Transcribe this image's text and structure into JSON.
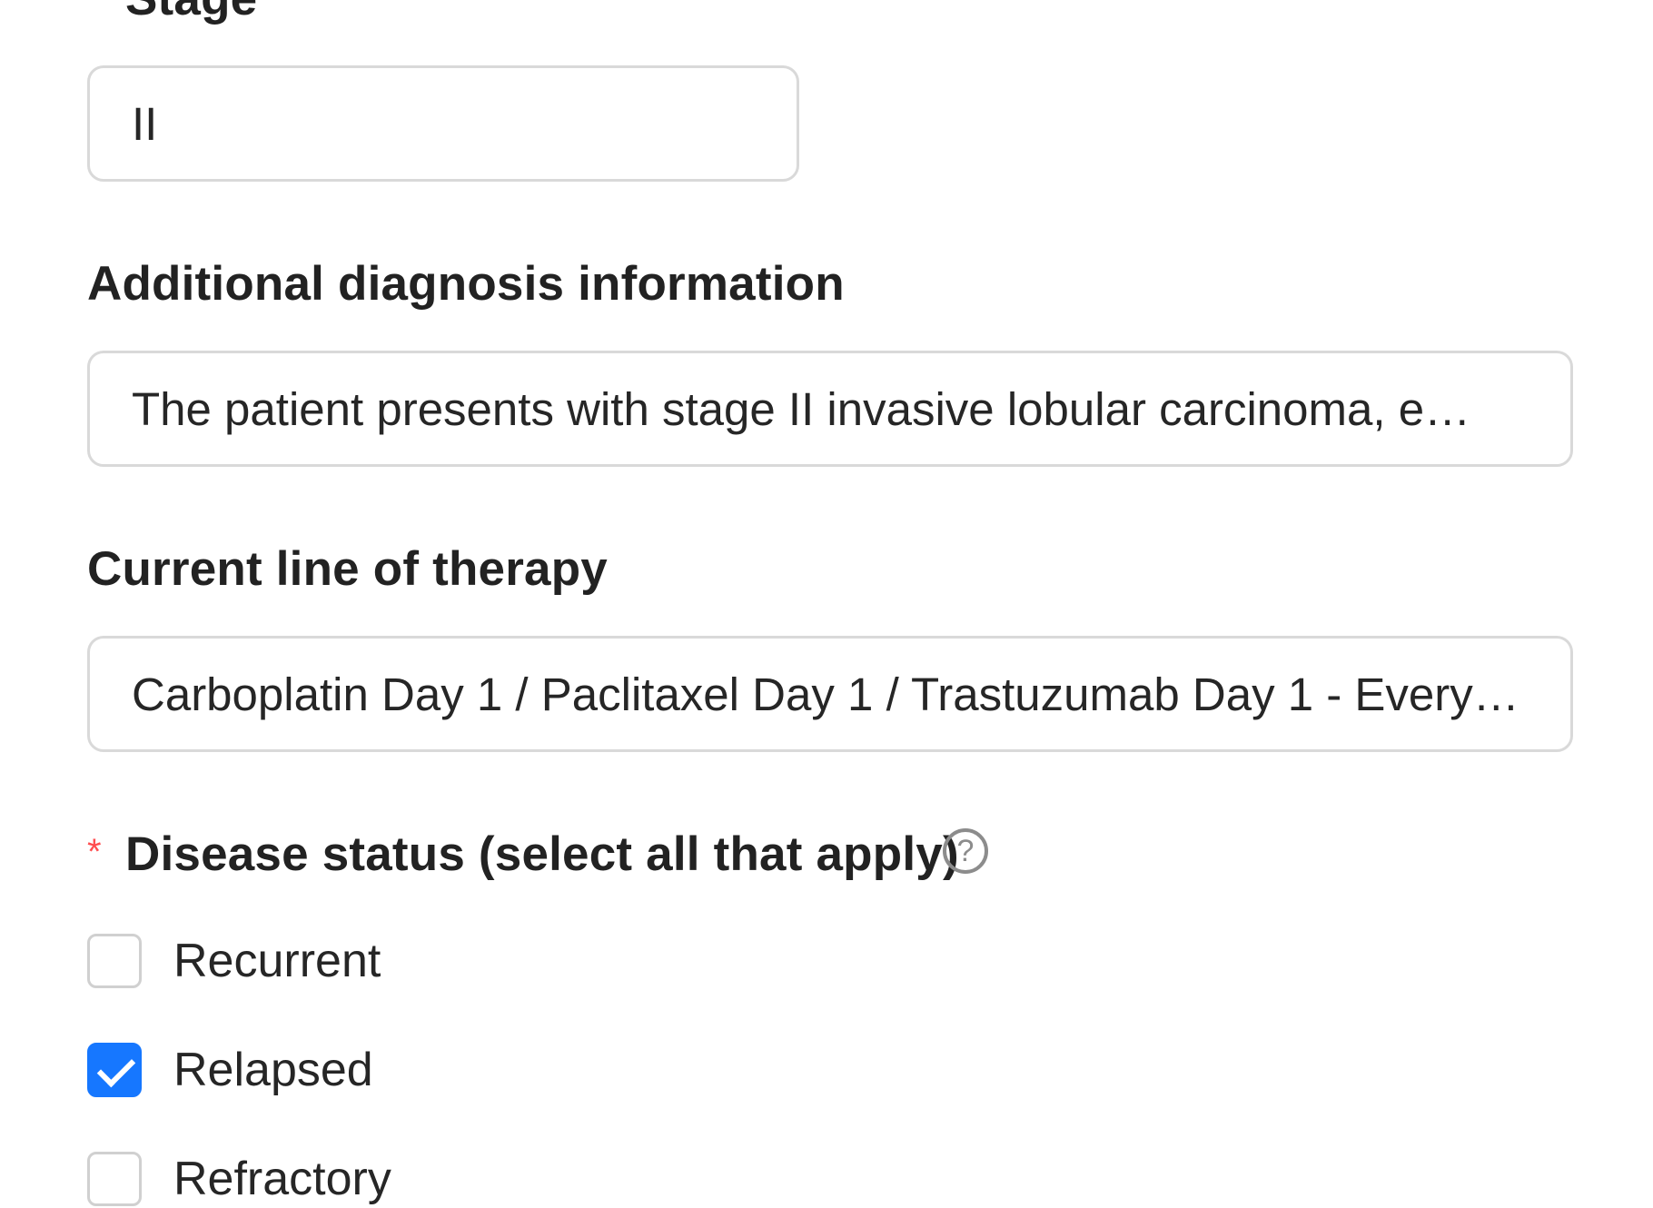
{
  "form": {
    "stage": {
      "label": "Stage",
      "value": "II"
    },
    "additional_diagnosis": {
      "label": "Additional diagnosis information",
      "value": "The patient presents with stage II invasive lobular carcinoma, e…"
    },
    "current_line_of_therapy": {
      "label": "Current line of therapy",
      "value": "Carboplatin Day 1 / Paclitaxel Day 1 / Trastuzumab Day 1 - Every…"
    },
    "disease_status": {
      "required_marker": "*",
      "label": "Disease status (select all that apply)",
      "help_icon_glyph": "?",
      "help_icon": "question-circle-icon",
      "options": [
        {
          "label": "Recurrent",
          "checked": false
        },
        {
          "label": "Relapsed",
          "checked": true
        },
        {
          "label": "Refractory",
          "checked": false
        }
      ]
    }
  },
  "colors": {
    "checkbox_checked": "#1677ff",
    "required_marker": "#ff4d4f",
    "field_border": "#d9d9d9"
  }
}
